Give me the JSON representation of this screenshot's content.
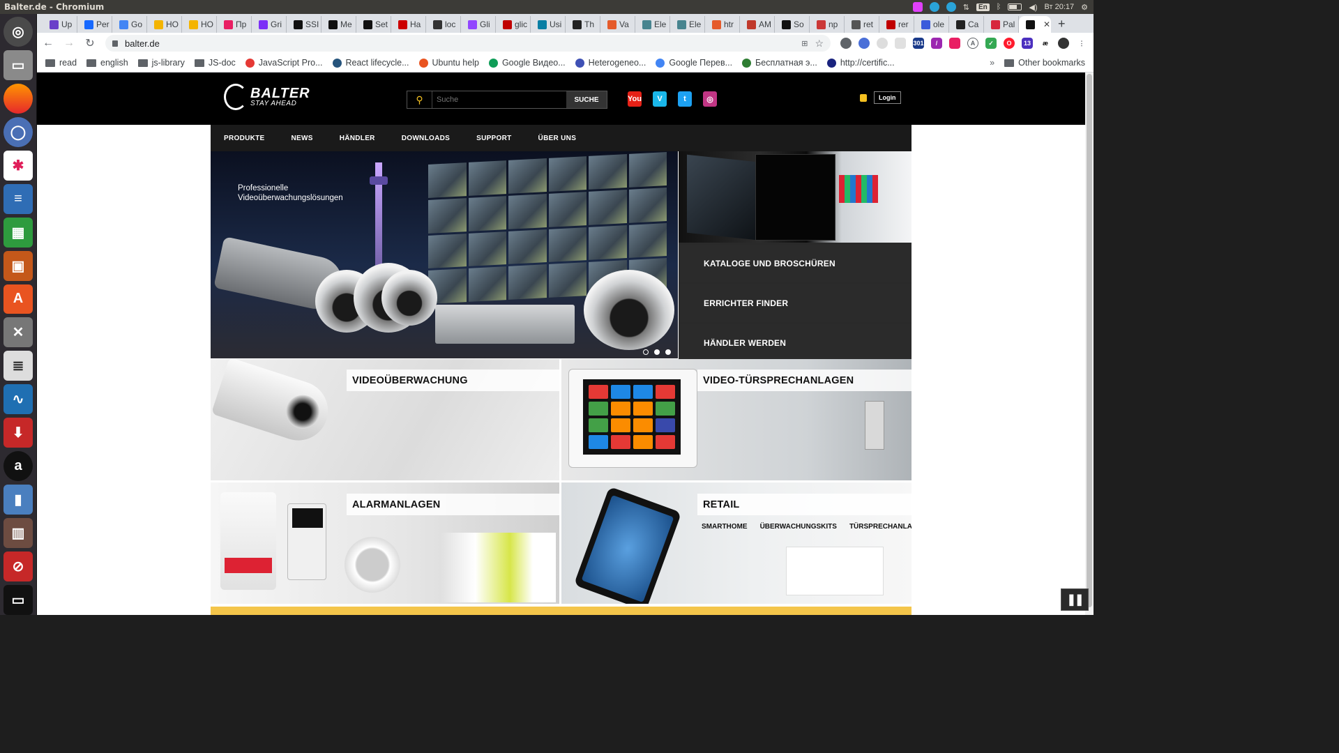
{
  "window": {
    "title": "Balter.de - Chromium"
  },
  "system": {
    "language": "En",
    "clock": "Вт 20:17"
  },
  "tabs": [
    {
      "label": "Up",
      "color": "#6a3fc9"
    },
    {
      "label": "Per",
      "color": "#1769ff"
    },
    {
      "label": "Go",
      "color": "#4285f4"
    },
    {
      "label": "HO",
      "color": "#f4b400"
    },
    {
      "label": "HO",
      "color": "#f4b400"
    },
    {
      "label": "Пр",
      "color": "#e91e63"
    },
    {
      "label": "Gri",
      "color": "#7b2ff7"
    },
    {
      "label": "SSI",
      "color": "#111111"
    },
    {
      "label": "Me",
      "color": "#111111"
    },
    {
      "label": "Set",
      "color": "#111111"
    },
    {
      "label": "Ha",
      "color": "#cc0000"
    },
    {
      "label": "loc",
      "color": "#333333"
    },
    {
      "label": "Gli",
      "color": "#9146ff"
    },
    {
      "label": "glic",
      "color": "#c00000"
    },
    {
      "label": "Usi",
      "color": "#087ea4"
    },
    {
      "label": "Th",
      "color": "#222222"
    },
    {
      "label": "Va",
      "color": "#e55b2b"
    },
    {
      "label": "Ele",
      "color": "#47848f"
    },
    {
      "label": "Ele",
      "color": "#47848f"
    },
    {
      "label": "htr",
      "color": "#e55b2b"
    },
    {
      "label": "AM",
      "color": "#c0392b"
    },
    {
      "label": "So",
      "color": "#111111"
    },
    {
      "label": "np",
      "color": "#cb3837"
    },
    {
      "label": "ret",
      "color": "#555555"
    },
    {
      "label": "rer",
      "color": "#c00000"
    },
    {
      "label": "ole",
      "color": "#3b5bdb"
    },
    {
      "label": "Ca",
      "color": "#222222"
    },
    {
      "label": "Pal",
      "color": "#d7263d"
    },
    {
      "label": "",
      "color": "#111111",
      "active": true
    }
  ],
  "toolbar": {
    "url": "balter.de"
  },
  "bookmarks": [
    {
      "label": "read",
      "type": "folder"
    },
    {
      "label": "english",
      "type": "folder"
    },
    {
      "label": "js-library",
      "type": "folder"
    },
    {
      "label": "JS-doc",
      "type": "folder"
    },
    {
      "label": "JavaScript Pro...",
      "type": "site",
      "color": "#e53935"
    },
    {
      "label": "React lifecycle...",
      "type": "site",
      "color": "#26547c"
    },
    {
      "label": "Ubuntu help",
      "type": "site",
      "color": "#e95420"
    },
    {
      "label": "Google Видео...",
      "type": "site",
      "color": "#0f9d58"
    },
    {
      "label": "Heterogeneo...",
      "type": "site",
      "color": "#3f51b5"
    },
    {
      "label": "Google Перев...",
      "type": "site",
      "color": "#4285f4"
    },
    {
      "label": "Бесплатная э...",
      "type": "site",
      "color": "#2e7d32"
    },
    {
      "label": "http://certific...",
      "type": "site",
      "color": "#1a237e"
    }
  ],
  "bookmarks_more": "»",
  "other_bookmarks": "Other bookmarks",
  "site": {
    "logo": {
      "wordmark": "BALTER",
      "tagline": "STAY AHEAD"
    },
    "search": {
      "placeholder": "Suche",
      "button": "SUCHE"
    },
    "social": [
      {
        "name": "youtube-icon",
        "color": "#e62117",
        "glyph": "You"
      },
      {
        "name": "vimeo-icon",
        "color": "#1ab7ea",
        "glyph": "V"
      },
      {
        "name": "twitter-icon",
        "color": "#1da1f2",
        "glyph": "t"
      },
      {
        "name": "instagram-icon",
        "color": "#c13584",
        "glyph": "◎"
      }
    ],
    "login": "Login",
    "nav": [
      "PRODUKTE",
      "NEWS",
      "HÄNDLER",
      "DOWNLOADS",
      "SUPPORT",
      "ÜBER UNS"
    ],
    "hero": {
      "line1": "Professionelle",
      "line2": "Videoüberwachungslösungen",
      "slides": 3,
      "active_slide": 2
    },
    "side_links": [
      "KATALOGE UND BROSCHÜREN",
      "ERRICHTER FINDER",
      "HÄNDLER WERDEN"
    ],
    "tiles": {
      "video": "VIDEOÜBERWACHUNG",
      "door": "VIDEO-TÜRSPRECHANLAGEN",
      "alarm": "ALARMANLAGEN",
      "retail": "RETAIL",
      "retail_links": [
        "SMARTHOME",
        "ÜBERWACHUNGSKITS",
        "TÜRSPRECHANLAGEN"
      ]
    }
  },
  "colors": {
    "accent": "#f4c020",
    "brand_bg": "#000000",
    "nav_bg": "#1a1a1a"
  }
}
